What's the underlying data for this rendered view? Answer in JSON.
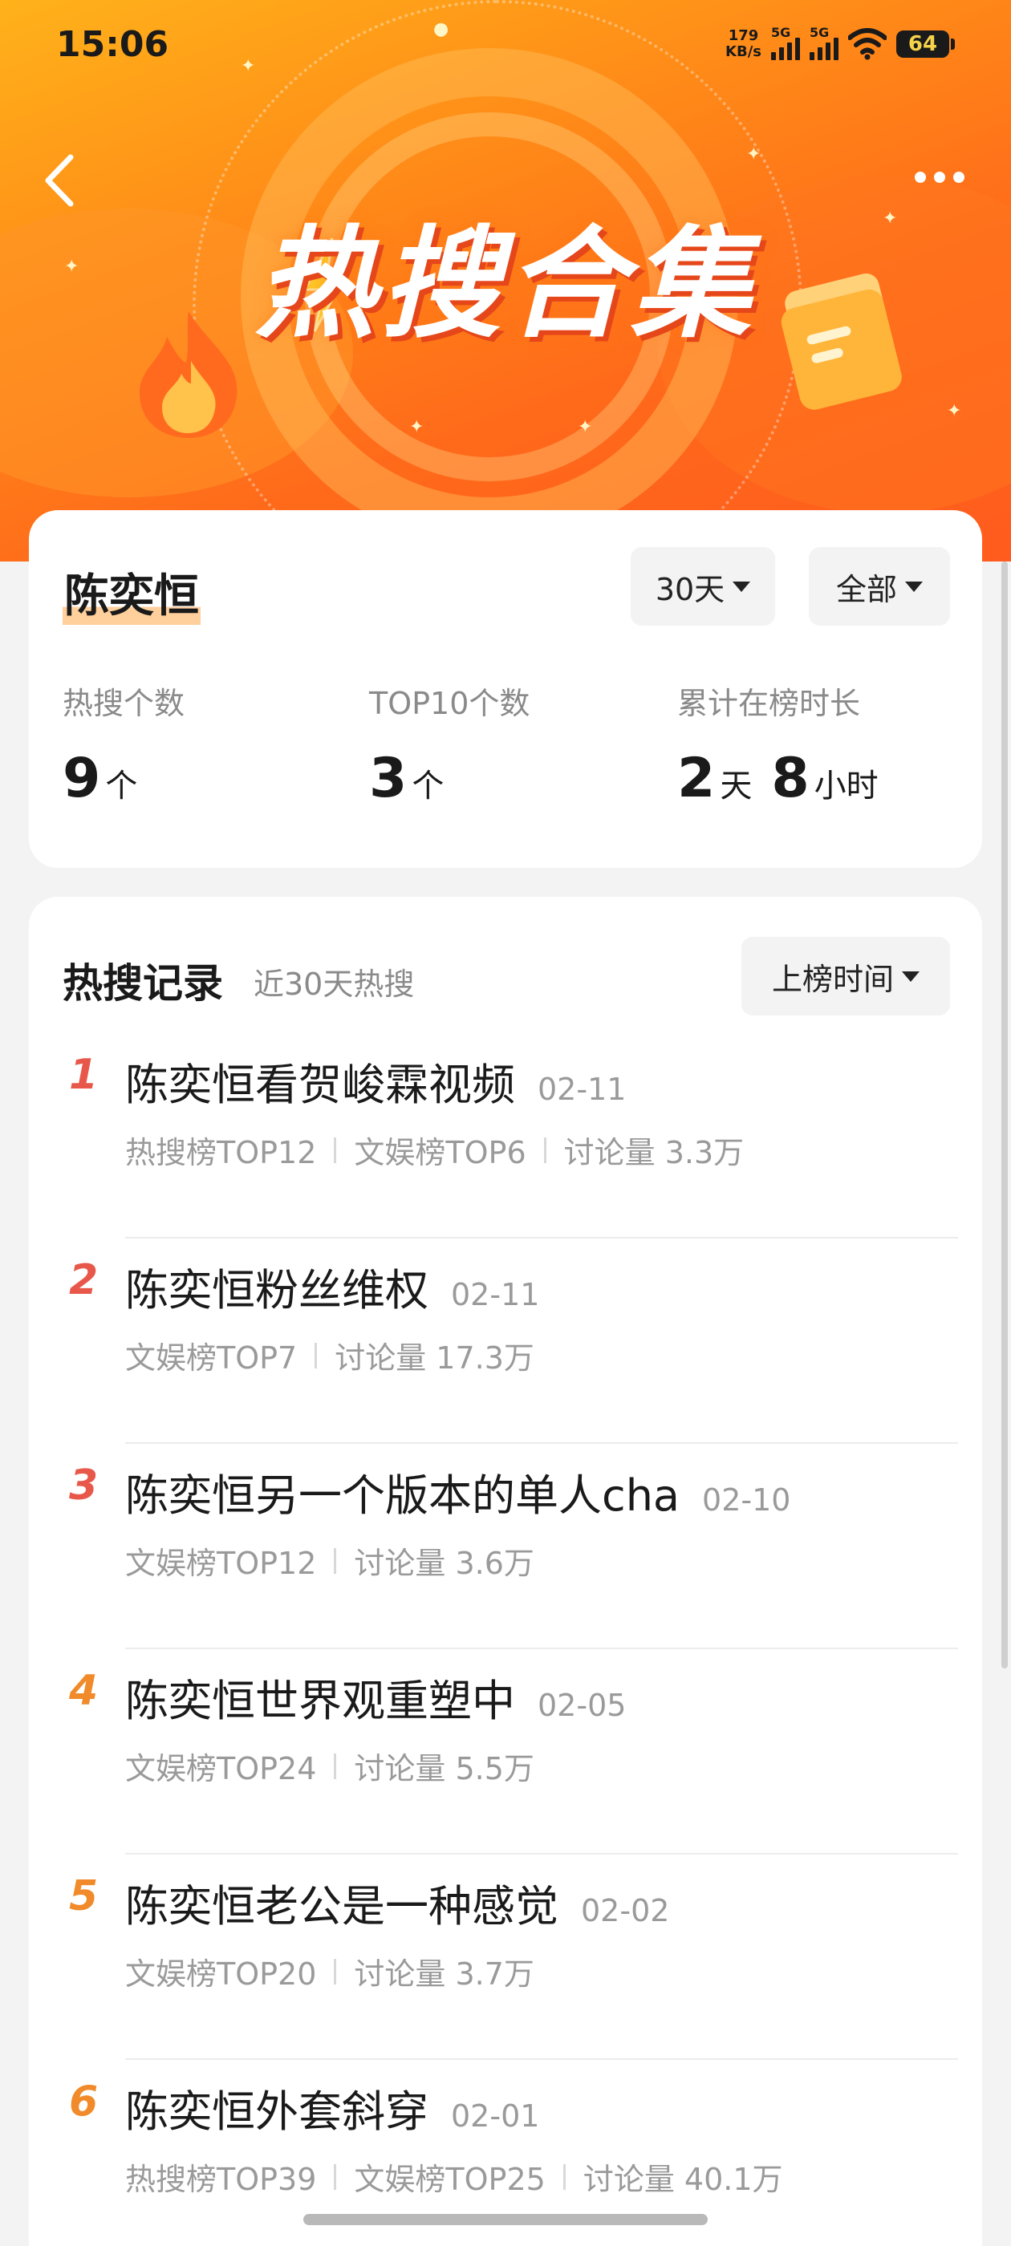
{
  "status_bar": {
    "time": "15:06",
    "net_speed_value": "179",
    "net_speed_unit": "KB/s",
    "signal_1_label": "5G",
    "signal_2_label": "5G",
    "battery": "64"
  },
  "banner": {
    "title": "热搜合集"
  },
  "summary": {
    "name": "陈奕恒",
    "range_filter": "30天",
    "type_filter": "全部",
    "stats": [
      {
        "label": "热搜个数",
        "value": "9",
        "unit": "个"
      },
      {
        "label": "TOP10个数",
        "value": "3",
        "unit": "个"
      },
      {
        "label": "累计在榜时长",
        "value_days": "2",
        "unit_days": "天",
        "value_hours": "8",
        "unit_hours": "小时"
      }
    ]
  },
  "records": {
    "title": "热搜记录",
    "subtitle": "近30天热搜",
    "sort_label": "上榜时间",
    "items": [
      {
        "rank": "1",
        "title": "陈奕恒看贺峻霖视频",
        "date": "02-11",
        "meta": [
          "热搜榜TOP12",
          "文娱榜TOP6",
          "讨论量 3.3万"
        ]
      },
      {
        "rank": "2",
        "title": "陈奕恒粉丝维权",
        "date": "02-11",
        "meta": [
          "文娱榜TOP7",
          "讨论量 17.3万"
        ]
      },
      {
        "rank": "3",
        "title": "陈奕恒另一个版本的单人cha",
        "date": "02-10",
        "meta": [
          "文娱榜TOP12",
          "讨论量 3.6万"
        ]
      },
      {
        "rank": "4",
        "title": "陈奕恒世界观重塑中",
        "date": "02-05",
        "meta": [
          "文娱榜TOP24",
          "讨论量 5.5万"
        ]
      },
      {
        "rank": "5",
        "title": "陈奕恒老公是一种感觉",
        "date": "02-02",
        "meta": [
          "文娱榜TOP20",
          "讨论量 3.7万"
        ]
      },
      {
        "rank": "6",
        "title": "陈奕恒外套斜穿",
        "date": "02-01",
        "meta": [
          "热搜榜TOP39",
          "文娱榜TOP25",
          "讨论量 40.1万"
        ]
      }
    ]
  },
  "colors": {
    "rank_top3": "#e8584a",
    "rank_other": "#f08a2a",
    "banner_orange": "#ff7a1a"
  }
}
